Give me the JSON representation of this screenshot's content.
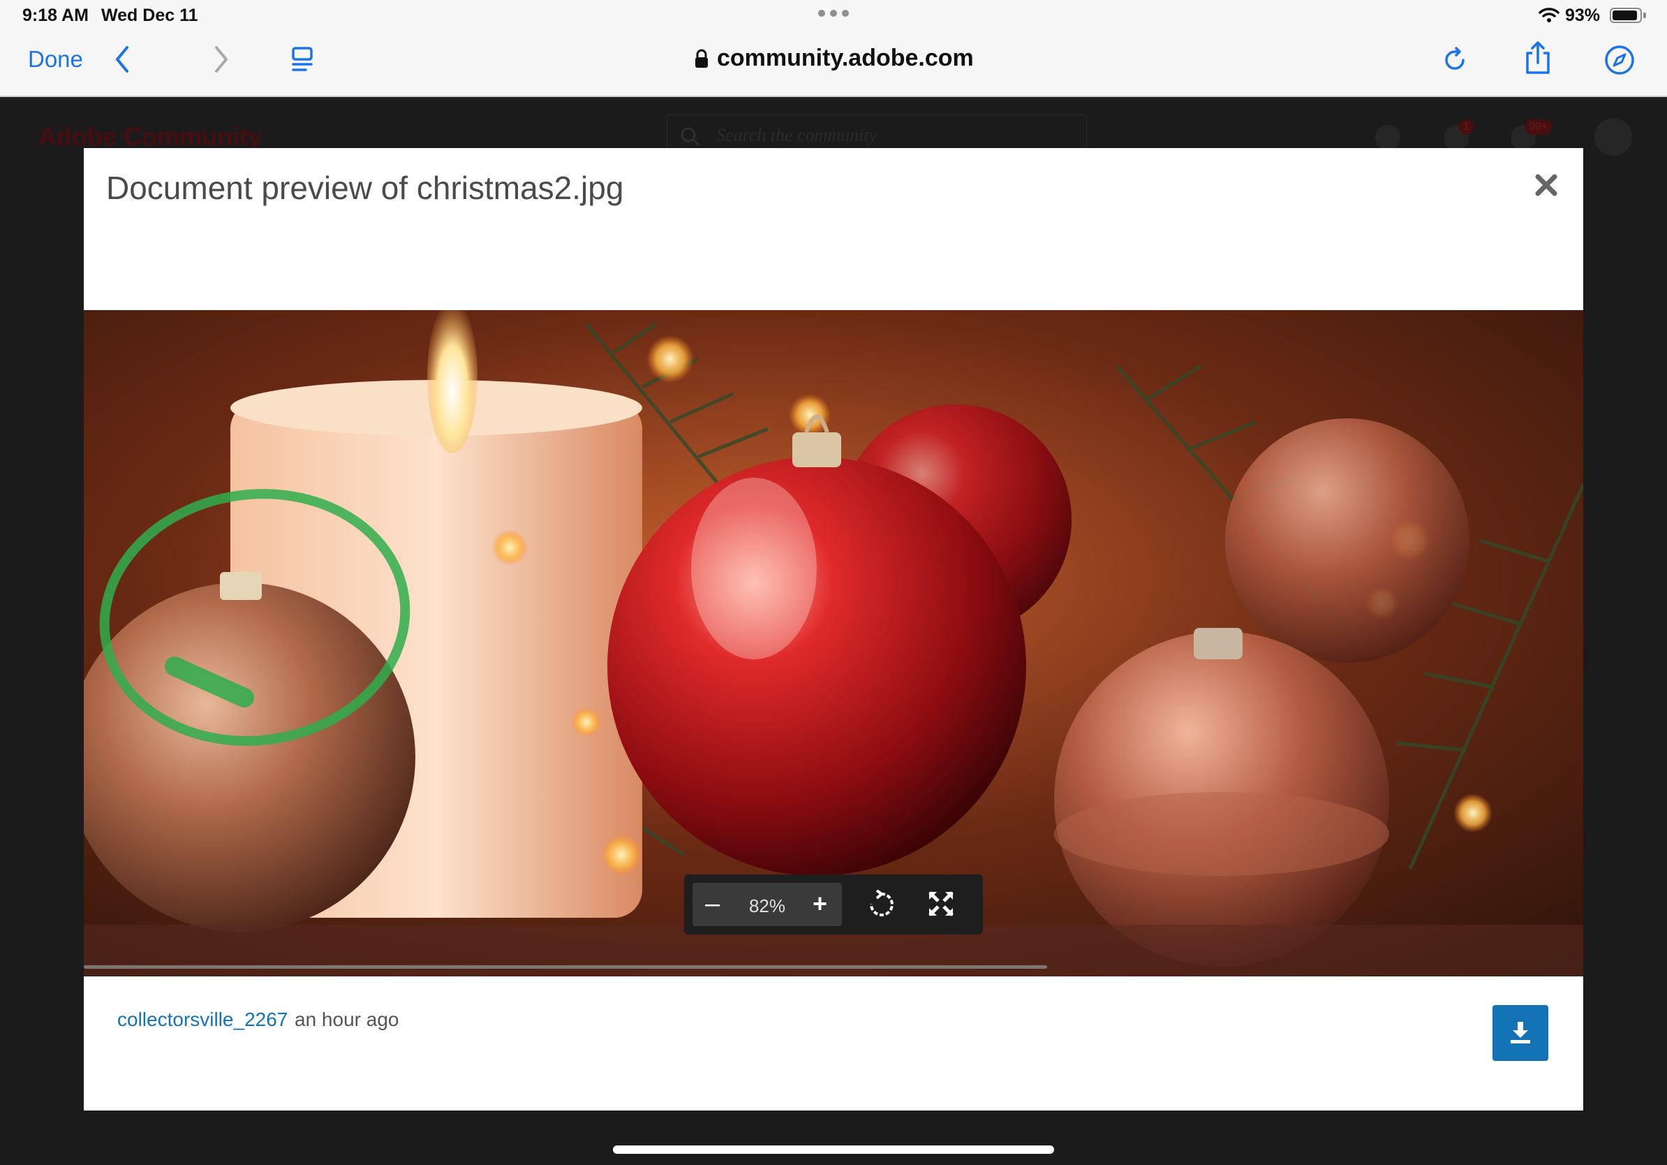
{
  "status_bar": {
    "time": "9:18 AM",
    "date": "Wed Dec 11",
    "battery": "93%",
    "battery_level": 0.93
  },
  "toolbar": {
    "done_label": "Done",
    "url": "community.adobe.com",
    "icons": [
      "chevron-left-icon",
      "chevron-right-icon",
      "reader-icon",
      "lock-icon",
      "reload-icon",
      "share-icon",
      "compass-icon"
    ]
  },
  "background_page": {
    "logo": "Adobe Community",
    "search_placeholder": "Search the community",
    "notification_count": "1",
    "alert_count": "99+"
  },
  "modal": {
    "title": "Document preview of christmas2.jpg",
    "viewer": {
      "zoom_minus": "–",
      "zoom_level": "82%",
      "zoom_plus": "+"
    },
    "author": "collectorsville_2267",
    "posted": "an hour ago"
  },
  "colors": {
    "accent": "#1473b7",
    "ios_blue": "#1a73e8",
    "annotation_green": "#2fae4c"
  }
}
